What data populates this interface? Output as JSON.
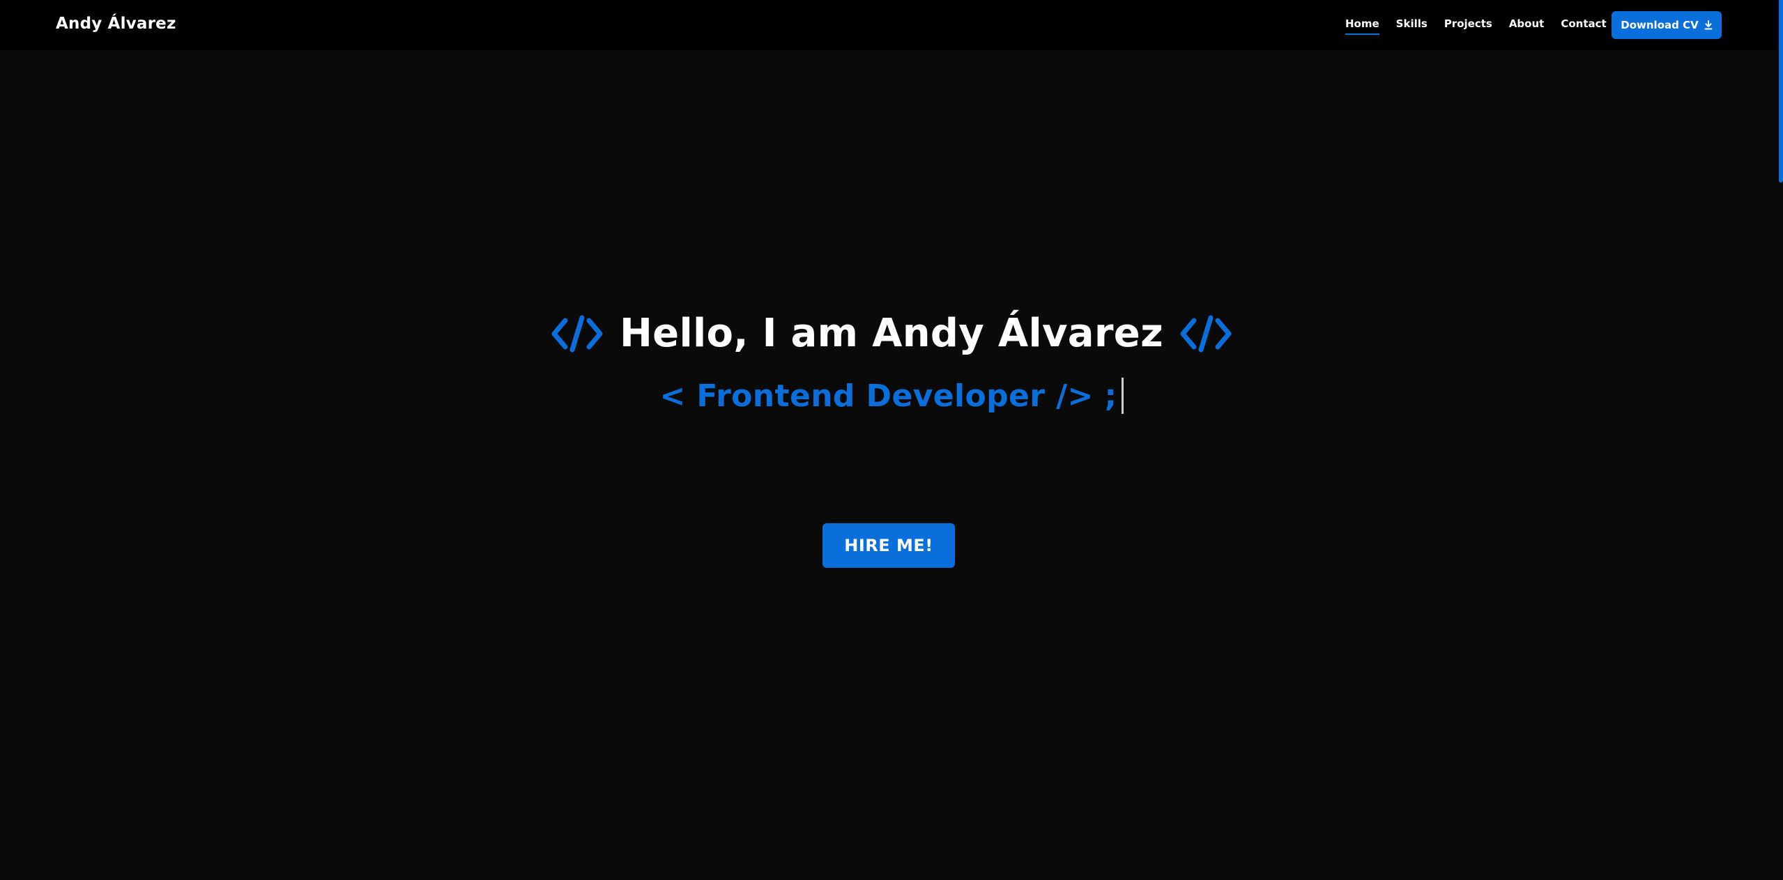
{
  "brand": {
    "name": "Andy Álvarez"
  },
  "nav": {
    "items": [
      {
        "label": "Home",
        "active": true
      },
      {
        "label": "Skills",
        "active": false
      },
      {
        "label": "Projects",
        "active": false
      },
      {
        "label": "About",
        "active": false
      },
      {
        "label": "Contact",
        "active": false
      }
    ],
    "download_cv": {
      "label": "Download CV",
      "icon": "download-icon"
    }
  },
  "hero": {
    "left_icon": "code-icon",
    "title": "Hello, I am Andy Álvarez",
    "right_icon": "code-icon",
    "subtitle": "< Frontend Developer /> ;",
    "cta_label": "HIRE ME!"
  },
  "colors": {
    "accent": "#0b6fdb",
    "background": "#0a0a0a",
    "navbar": "#000000",
    "text": "#ffffff"
  }
}
